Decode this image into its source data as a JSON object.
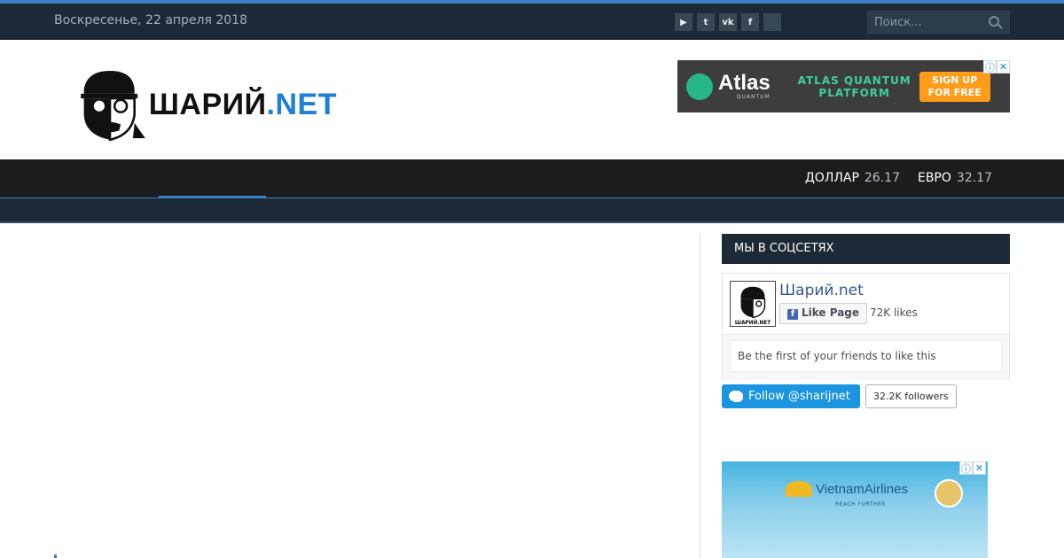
{
  "topbar": {
    "date": "Воскресенье, 22 апреля 2018",
    "socials": [
      {
        "label": "You Tube",
        "icon": "youtube-icon",
        "glyph": "▶"
      },
      {
        "label": "Twitter",
        "icon": "twitter-icon",
        "glyph": "t"
      },
      {
        "label": "VK",
        "icon": "vk-icon",
        "glyph": "vk"
      },
      {
        "label": "Facebook",
        "icon": "facebook-icon",
        "glyph": "f"
      },
      {
        "label": "",
        "icon": "blank-social-icon",
        "glyph": ""
      }
    ],
    "search_placeholder": "Поиск..."
  },
  "header": {
    "logo_main": "ШАРИЙ",
    "logo_net": ".NET",
    "ad": {
      "brand": "Atlas",
      "brand_sub": "QUANTUM",
      "headline": "ATLAS QUANTUM PLATFORM",
      "cta": "SIGN UP FOR FREE"
    }
  },
  "nav": {
    "rates": [
      {
        "name": "ДОЛЛАР",
        "value": "26.17"
      },
      {
        "name": "ЕВРО",
        "value": "32.17"
      }
    ]
  },
  "sidebar": {
    "widget_title": "МЫ В СОЦСЕТЯХ",
    "facebook": {
      "page_name": "Шарий.net",
      "like_label": "Like Page",
      "likes": "72K likes",
      "note": "Be the first of your friends to like this"
    },
    "twitter": {
      "follow_label": "Follow @sharijnet",
      "followers": "32.2K followers"
    },
    "ad2": {
      "brand": "VietnamAirlines",
      "tagline": "REACH FURTHER"
    }
  },
  "colors": {
    "accent": "#3f80c3",
    "topbar": "#1d2a36",
    "navbar": "#1a1c1e"
  }
}
